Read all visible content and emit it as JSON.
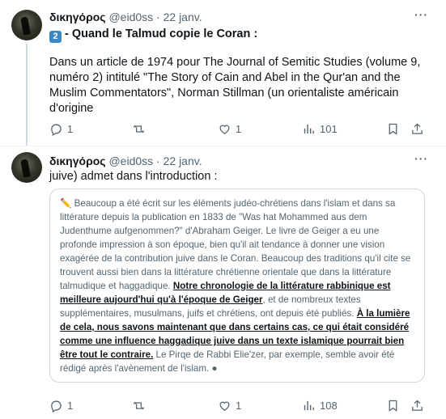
{
  "tweets": [
    {
      "display_name": "δικηγόρος",
      "handle": "@eid0ss",
      "separator": "·",
      "date": "22 janv.",
      "number_badge": "2",
      "title_text": "- Quand le Talmud copie le Coran :",
      "body_text": "Dans un article de 1974 pour The Journal of Semitic Studies (volume 9, numéro 2) intitulé \"The Story of Cain and Abel in the Qur'an and the Muslim Commentators\", Norman Stillman (un orientaliste américain d'origine",
      "more_label": "···",
      "actions": {
        "replies": "1",
        "reposts": "",
        "likes": "1",
        "views": "101"
      }
    },
    {
      "display_name": "δικηγόρος",
      "handle": "@eid0ss",
      "separator": "·",
      "date": "22 janv.",
      "body_text": "juive) admet dans l'introduction :",
      "more_label": "···",
      "quote": {
        "pencil": "✏️",
        "part1": "Beaucoup a été écrit sur les éléments judéo-chrétiens dans l'islam et dans sa littérature depuis la publication en 1833 de \"Was hat Mohammed aus dem Judenthume aufgenommen?\" d'Abraham Geiger. Le livre de Geiger a eu une profonde impression à son époque, bien qu'il ait tendance à donner une vision exagérée de la contribution juive dans le Coran. Beaucoup des traditions qu'il cite se trouvent aussi bien dans la littérature chrétienne orientale que dans la littérature talmudique et haggadique. ",
        "underline1": "Notre chronologie de la littérature rabbinique est meilleure aujourd'hui qu'à l'époque de Geiger",
        "part2": ", et de nombreux textes supplémentaires, musulmans, juifs et chrétiens, ont depuis été publiés. ",
        "underline2": "À la lumière de cela, nous savons maintenant que dans certains cas, ce qui était considéré comme une influence haggadique juive dans un texte islamique pourrait bien être tout le contraire.",
        "part3": " Le Pirqe de Rabbi Elie'zer, par exemple, semble avoir été rédigé après l'avènement de l'islam. ●"
      },
      "actions": {
        "replies": "1",
        "reposts": "",
        "likes": "1",
        "views": "108"
      }
    }
  ],
  "icons": [
    "reply-icon",
    "repost-icon",
    "like-icon",
    "views-icon",
    "bookmark-icon",
    "share-icon",
    "more-icon"
  ]
}
